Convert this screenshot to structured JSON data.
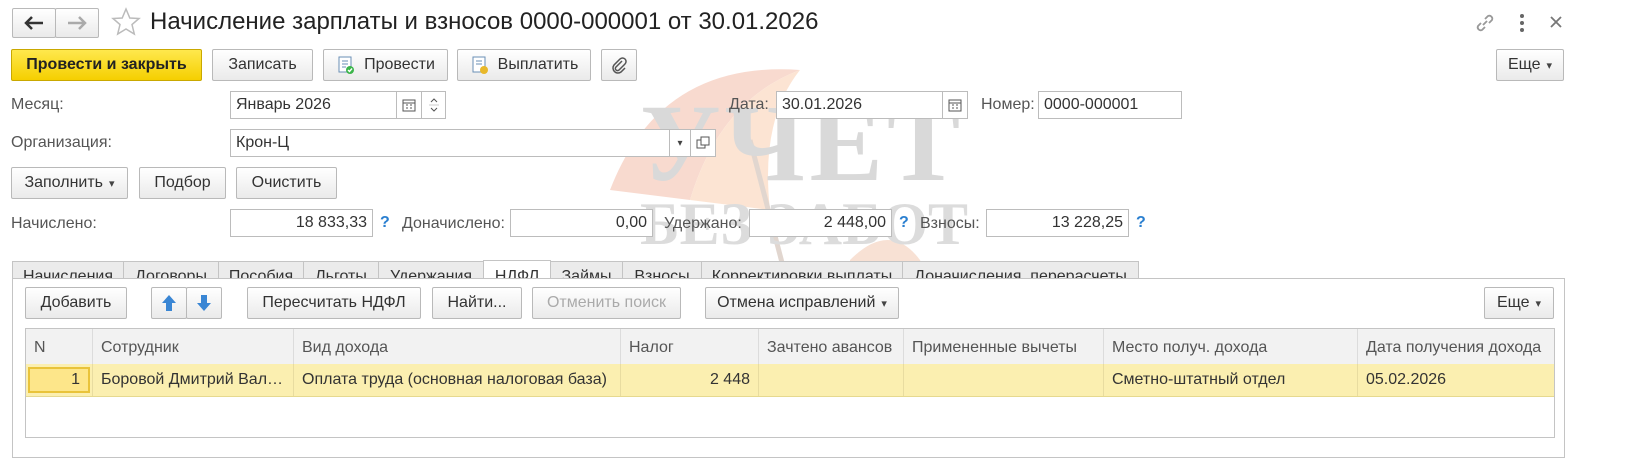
{
  "window": {
    "title": "Начисление зарплаты и взносов 0000-000001 от 30.01.2026"
  },
  "toolbar": {
    "post_close": "Провести и закрыть",
    "save": "Записать",
    "post": "Провести",
    "pay": "Выплатить",
    "more": "Еще"
  },
  "header": {
    "month_label": "Месяц:",
    "month_value": "Январь 2026",
    "date_label": "Дата:",
    "date_value": "30.01.2026",
    "number_label": "Номер:",
    "number_value": "0000-000001",
    "org_label": "Организация:",
    "org_value": "Крон-Ц"
  },
  "actions": {
    "fill": "Заполнить",
    "select": "Подбор",
    "clear": "Очистить"
  },
  "totals": {
    "accrued_label": "Начислено:",
    "accrued_value": "18 833,33",
    "additional_label": "Доначислено:",
    "additional_value": "0,00",
    "withheld_label": "Удержано:",
    "withheld_value": "2 448,00",
    "contributions_label": "Взносы:",
    "contributions_value": "13 228,25",
    "help": "?"
  },
  "tabs": [
    {
      "label": "Начисления"
    },
    {
      "label": "Договоры"
    },
    {
      "label": "Пособия"
    },
    {
      "label": "Льготы"
    },
    {
      "label": "Удержания"
    },
    {
      "label": "НДФЛ",
      "active": true
    },
    {
      "label": "Займы"
    },
    {
      "label": "Взносы"
    },
    {
      "label": "Корректировки выплаты"
    },
    {
      "label": "Доначисления, перерасчеты"
    }
  ],
  "tab_toolbar": {
    "add": "Добавить",
    "recalc": "Пересчитать НДФЛ",
    "find": "Найти...",
    "cancel_search": "Отменить поиск",
    "cancel_corrections": "Отмена исправлений",
    "more": "Еще"
  },
  "table": {
    "columns": [
      "N",
      "Сотрудник",
      "Вид дохода",
      "Налог",
      "Зачтено авансов",
      "Примененные вычеты",
      "Место получ. дохода",
      "Дата получения дохода"
    ],
    "rows": [
      {
        "n": "1",
        "employee": "Боровой Дмитрий Вал…",
        "income_type": "Оплата труда (основная налоговая база)",
        "tax": "2 448",
        "advances": "",
        "deductions": "",
        "place": "Сметно-штатный отдел",
        "date": "05.02.2026"
      }
    ]
  },
  "watermark": {
    "line1": "УЧЕТ",
    "line2": "БЕЗ ЗАБОТ"
  },
  "colors": {
    "primary_button": "#f5cf00",
    "selected_row": "#fbefb0",
    "help_icon": "#2a7fd0"
  }
}
